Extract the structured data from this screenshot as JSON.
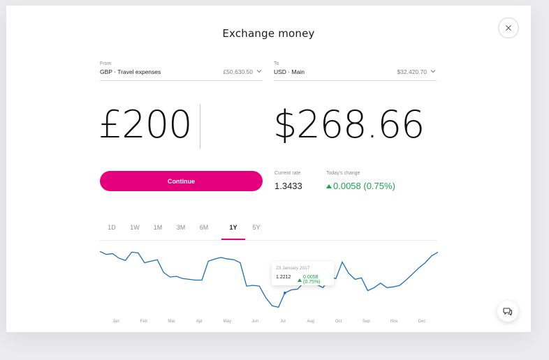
{
  "title": "Exchange money",
  "icons": {
    "close": "close-icon",
    "chevron": "chevron-down-icon",
    "chat": "chat-icon"
  },
  "from": {
    "label": "From",
    "account": "GBP · Travel expenses",
    "balance": "£50,630.50"
  },
  "to": {
    "label": "To",
    "account": "USD · Main",
    "balance": "$32,420.70"
  },
  "amount_from": "£200",
  "amount_to": "$268.66",
  "continue_label": "Continue",
  "current_rate": {
    "label": "Current rate",
    "value": "1.3433"
  },
  "todays_change": {
    "label": "Today's change",
    "value": "0.0058 (0.75%)"
  },
  "tabs": [
    {
      "label": "1D",
      "active": false
    },
    {
      "label": "1W",
      "active": false
    },
    {
      "label": "1M",
      "active": false
    },
    {
      "label": "3M",
      "active": false
    },
    {
      "label": "6M",
      "active": false
    },
    {
      "label": "1Y",
      "active": true
    },
    {
      "label": "5Y",
      "active": false
    }
  ],
  "tooltip": {
    "date": "23 January 2017",
    "value": "1.2212",
    "change": "0.0058 (0.75%)"
  },
  "colors": {
    "accent": "#e5007e",
    "line": "#1a6fb8",
    "positive": "#1aa34a"
  },
  "chart_data": {
    "type": "line",
    "categories": [
      "Jan",
      "Feb",
      "Mar",
      "Apr",
      "May",
      "Jun",
      "Jul",
      "Aug",
      "Oct",
      "Sep",
      "Nov",
      "Dec"
    ],
    "series": [
      {
        "values": [
          1.296,
          1.292,
          1.293,
          1.287,
          1.284,
          1.295,
          1.294,
          1.281,
          1.283,
          1.285,
          1.268,
          1.262,
          1.263,
          1.26,
          1.259,
          1.258,
          1.258,
          1.283,
          1.286,
          1.288,
          1.286,
          1.285,
          1.281,
          1.25,
          1.251,
          1.25,
          1.235,
          1.224,
          1.222,
          1.241,
          1.245,
          1.246,
          1.255,
          1.254,
          1.252,
          1.248,
          1.262,
          1.26,
          1.282,
          1.267,
          1.259,
          1.261,
          1.244,
          1.248,
          1.254,
          1.248,
          1.249,
          1.251,
          1.258,
          1.266,
          1.274,
          1.281,
          1.29,
          1.295
        ]
      }
    ]
  }
}
